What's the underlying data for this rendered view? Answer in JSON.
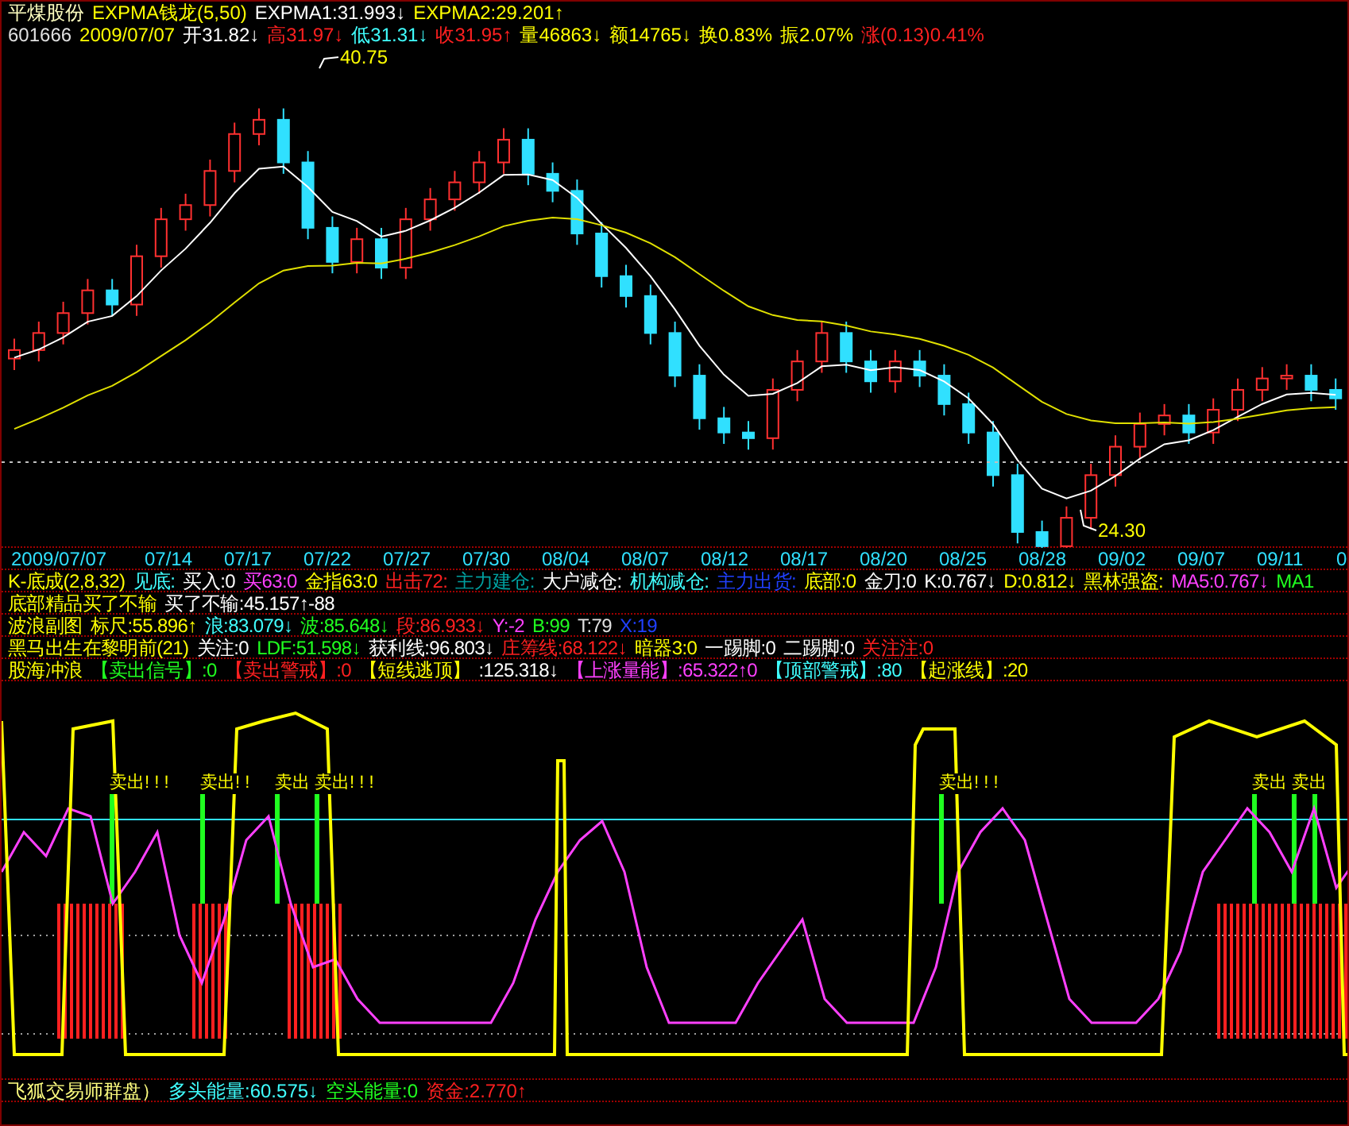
{
  "header_lines": [
    [
      {
        "text": "平煤股份",
        "color": "#ffffc0"
      },
      {
        "text": "EXPMA钱龙(5,50)",
        "color": "#ffff00"
      },
      {
        "text": "EXPMA1:31.993↓",
        "color": "#ffffff"
      },
      {
        "text": "EXPMA2:29.201↑",
        "color": "#ffff00"
      }
    ],
    [
      {
        "text": "601666",
        "color": "#e0e0e0"
      },
      {
        "text": "2009/07/07",
        "color": "#ffff00"
      },
      {
        "text": "开31.82↓",
        "color": "#ffffff"
      },
      {
        "text": "高31.97↓",
        "color": "#ff2020"
      },
      {
        "text": "低31.31↓",
        "color": "#40ffff"
      },
      {
        "text": "收31.95↑",
        "color": "#ff2020"
      },
      {
        "text": "量46863↓",
        "color": "#ffff00"
      },
      {
        "text": "额14765↓",
        "color": "#ffff00"
      },
      {
        "text": "换0.83%",
        "color": "#ffff00"
      },
      {
        "text": "振2.07%",
        "color": "#ffff00"
      },
      {
        "text": "涨(0.13)0.41%",
        "color": "#ff2020"
      }
    ]
  ],
  "price_chart": {
    "high_label": "40.75",
    "low_label": "24.30"
  },
  "x_axis": [
    "2009/07/07",
    "07/14",
    "07/17",
    "07/22",
    "07/27",
    "07/30",
    "08/04",
    "08/07",
    "08/12",
    "08/17",
    "08/20",
    "08/25",
    "08/28",
    "09/02",
    "09/07",
    "09/11",
    "0"
  ],
  "indicator_lines": [
    [
      {
        "text": "K-底成(2,8,32)",
        "color": "#ffff00"
      },
      {
        "text": "见底:",
        "color": "#40ffff"
      },
      {
        "text": "买入:0",
        "color": "#ffffff"
      },
      {
        "text": "买63:0",
        "color": "#ff40ff"
      },
      {
        "text": "金指63:0",
        "color": "#ffff00"
      },
      {
        "text": "出击72:",
        "color": "#ff2020"
      },
      {
        "text": "主力建仓:",
        "color": "#00a0a0"
      },
      {
        "text": "大户减仓:",
        "color": "#ffffff"
      },
      {
        "text": "机构减仓:",
        "color": "#40ffff"
      },
      {
        "text": "主力出货:",
        "color": "#2040ff"
      },
      {
        "text": "底部:0",
        "color": "#ffff00"
      },
      {
        "text": "金刀:0",
        "color": "#ffffff"
      },
      {
        "text": "K:0.767↓",
        "color": "#ffffff"
      },
      {
        "text": "D:0.812↓",
        "color": "#ffff00"
      },
      {
        "text": "黑林强盗:",
        "color": "#ffff00"
      },
      {
        "text": "MA5:0.767↓",
        "color": "#ff40ff"
      },
      {
        "text": "MA1",
        "color": "#20ff20"
      }
    ],
    [
      {
        "text": "底部精品买了不输",
        "color": "#ffff00"
      },
      {
        "text": "买了不输:45.157↑-88",
        "color": "#ffffff"
      }
    ],
    [
      {
        "text": "波浪副图",
        "color": "#ffff00"
      },
      {
        "text": "标尺:55.896↑",
        "color": "#ffff00"
      },
      {
        "text": "浪:83.079↓",
        "color": "#40ffff"
      },
      {
        "text": "波:85.648↓",
        "color": "#20ff20"
      },
      {
        "text": "段:86.933↓",
        "color": "#ff2020"
      },
      {
        "text": "Y:-2",
        "color": "#ff40ff"
      },
      {
        "text": "B:99",
        "color": "#20ff20"
      },
      {
        "text": "T:79",
        "color": "#e0e0e0"
      },
      {
        "text": "X:19",
        "color": "#2040ff"
      }
    ],
    [
      {
        "text": "黑马出生在黎明前(21)",
        "color": "#ffff00"
      },
      {
        "text": "关注:0",
        "color": "#ffffff"
      },
      {
        "text": "LDF:51.598↓",
        "color": "#20ff20"
      },
      {
        "text": "获利线:96.803↓",
        "color": "#ffffff"
      },
      {
        "text": "庄筹线:68.122↓",
        "color": "#ff2020"
      },
      {
        "text": "暗器3:0",
        "color": "#ffff00"
      },
      {
        "text": "一踢脚:0",
        "color": "#ffffff"
      },
      {
        "text": "二踢脚:0",
        "color": "#ffffff"
      },
      {
        "text": "关注注:0",
        "color": "#ff2020"
      }
    ],
    [
      {
        "text": "股海冲浪",
        "color": "#ffff00"
      },
      {
        "text": "【卖出信号】:0",
        "color": "#20ff20"
      },
      {
        "text": "【卖出警戒】:0",
        "color": "#ff2020"
      },
      {
        "text": "【短线逃顶】",
        "color": "#ffff00"
      },
      {
        "text": ":125.318↓",
        "color": "#ffffff"
      },
      {
        "text": "【上涨量能】:65.322↑0",
        "color": "#ff40ff"
      },
      {
        "text": "【顶部警戒】:80",
        "color": "#40ffff"
      },
      {
        "text": "【起涨线】:20",
        "color": "#ffff00"
      }
    ]
  ],
  "sell_labels": [
    "卖出! ! !",
    "卖出! !",
    "卖出",
    "卖出! ! !",
    "卖出! ! !",
    "卖出",
    "卖出"
  ],
  "bottom_line": [
    {
      "text": "飞狐交易师群盘）",
      "color": "#ffff80"
    },
    {
      "text": "多头能量:60.575↓",
      "color": "#40ffff"
    },
    {
      "text": "空头能量:0",
      "color": "#20ff20"
    },
    {
      "text": "资金:2.770↑",
      "color": "#ff2020"
    }
  ]
}
